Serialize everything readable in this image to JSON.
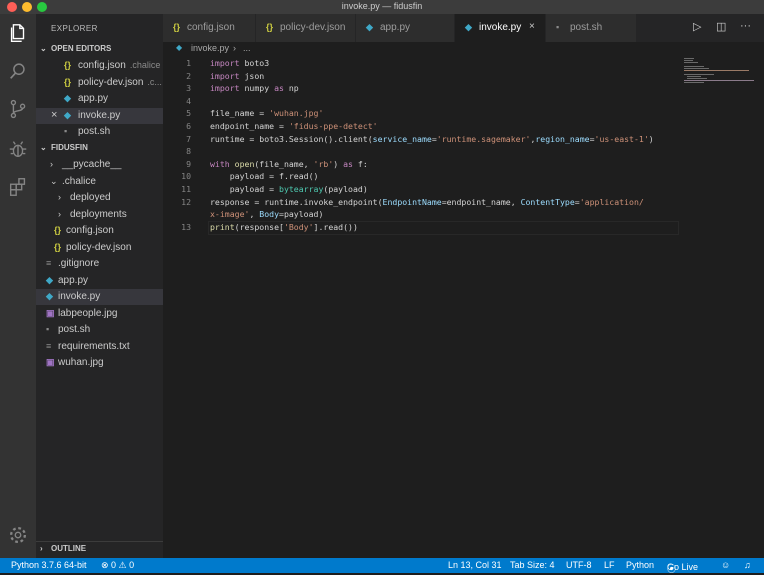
{
  "window": {
    "title": "invoke.py — fidusfin"
  },
  "sidebar": {
    "title": "EXPLORER",
    "open_editors_label": "OPEN EDITORS",
    "open_editors": [
      {
        "icon": "{}",
        "color": "#cbcb41",
        "name": "config.json",
        "suffix": ".chalice"
      },
      {
        "icon": "{}",
        "color": "#cbcb41",
        "name": "policy-dev.json",
        "suffix": ".c..."
      },
      {
        "icon": "◆",
        "color": "#3fa8c7",
        "name": "app.py",
        "suffix": ""
      },
      {
        "icon": "◆",
        "color": "#3fa8c7",
        "name": "invoke.py",
        "suffix": ""
      },
      {
        "icon": "▪",
        "color": "#8b8b8b",
        "name": "post.sh",
        "suffix": ""
      }
    ],
    "project_label": "FIDUSFIN",
    "tree": [
      {
        "chevron": "›",
        "icon": "",
        "color": "",
        "name": "__pycache__"
      },
      {
        "chevron": "⌄",
        "icon": "",
        "color": "",
        "name": ".chalice"
      },
      {
        "chevron": "›",
        "icon": "",
        "color": "",
        "name": "deployed"
      },
      {
        "chevron": "›",
        "icon": "",
        "color": "",
        "name": "deployments"
      },
      {
        "chevron": "",
        "icon": "{}",
        "color": "#cbcb41",
        "name": "config.json"
      },
      {
        "chevron": "",
        "icon": "{}",
        "color": "#cbcb41",
        "name": "policy-dev.json"
      },
      {
        "chevron": "",
        "icon": "≡",
        "color": "#8b8b8b",
        "name": ".gitignore"
      },
      {
        "chevron": "",
        "icon": "◆",
        "color": "#3fa8c7",
        "name": "app.py"
      },
      {
        "chevron": "",
        "icon": "◆",
        "color": "#3fa8c7",
        "name": "invoke.py"
      },
      {
        "chevron": "",
        "icon": "▣",
        "color": "#a074c4",
        "name": "labpeople.jpg"
      },
      {
        "chevron": "",
        "icon": "▪",
        "color": "#8b8b8b",
        "name": "post.sh"
      },
      {
        "chevron": "",
        "icon": "≡",
        "color": "#8b8b8b",
        "name": "requirements.txt"
      },
      {
        "chevron": "",
        "icon": "▣",
        "color": "#a074c4",
        "name": "wuhan.jpg"
      }
    ],
    "outline_label": "OUTLINE"
  },
  "tabs": [
    {
      "icon": "{}",
      "color": "#cbcb41",
      "name": "config.json"
    },
    {
      "icon": "{}",
      "color": "#cbcb41",
      "name": "policy-dev.json"
    },
    {
      "icon": "◆",
      "color": "#3fa8c7",
      "name": "app.py"
    },
    {
      "icon": "◆",
      "color": "#3fa8c7",
      "name": "invoke.py"
    },
    {
      "icon": "▪",
      "color": "#8b8b8b",
      "name": "post.sh"
    }
  ],
  "tab_actions": {
    "run": "▷",
    "split": "◫",
    "more": "···"
  },
  "breadcrumb": {
    "file": "invoke.py",
    "sep": "›",
    "rest": "..."
  },
  "code_lines": [
    {
      "num": "1",
      "tokens": [
        [
          "kw",
          "import"
        ],
        [
          "txt",
          " boto3"
        ]
      ]
    },
    {
      "num": "2",
      "tokens": [
        [
          "kw",
          "import"
        ],
        [
          "txt",
          " json"
        ]
      ]
    },
    {
      "num": "3",
      "tokens": [
        [
          "kw",
          "import"
        ],
        [
          "txt",
          " numpy "
        ],
        [
          "kw",
          "as"
        ],
        [
          "txt",
          " np"
        ]
      ]
    },
    {
      "num": "4",
      "tokens": []
    },
    {
      "num": "5",
      "tokens": [
        [
          "txt",
          "file_name = "
        ],
        [
          "str",
          "'wuhan.jpg'"
        ]
      ]
    },
    {
      "num": "6",
      "tokens": [
        [
          "txt",
          "endpoint_name = "
        ],
        [
          "str",
          "'fidus-ppe-detect'"
        ]
      ]
    },
    {
      "num": "7",
      "tokens": [
        [
          "txt",
          "runtime = boto3.Session().client("
        ],
        [
          "var",
          "service_name"
        ],
        [
          "txt",
          "="
        ],
        [
          "str",
          "'runtime.sagemaker'"
        ],
        [
          "txt",
          ","
        ],
        [
          "var",
          "region_name"
        ],
        [
          "txt",
          "="
        ],
        [
          "str",
          "'us-east-1'"
        ],
        [
          "txt",
          ")"
        ]
      ]
    },
    {
      "num": "8",
      "tokens": []
    },
    {
      "num": "9",
      "tokens": [
        [
          "kw",
          "with"
        ],
        [
          "txt",
          " "
        ],
        [
          "fn",
          "open"
        ],
        [
          "txt",
          "(file_name, "
        ],
        [
          "str",
          "'rb'"
        ],
        [
          "txt",
          ") "
        ],
        [
          "kw",
          "as"
        ],
        [
          "txt",
          " f:"
        ]
      ]
    },
    {
      "num": "10",
      "tokens": [
        [
          "txt",
          "    payload = f.read()"
        ]
      ]
    },
    {
      "num": "11",
      "tokens": [
        [
          "txt",
          "    payload = "
        ],
        [
          "cls2",
          "bytearray"
        ],
        [
          "txt",
          "(payload)"
        ]
      ]
    },
    {
      "num": "12",
      "tokens": [
        [
          "txt",
          "response = runtime.invoke_endpoint("
        ],
        [
          "var",
          "EndpointName"
        ],
        [
          "txt",
          "=endpoint_name, "
        ],
        [
          "var",
          "ContentType"
        ],
        [
          "txt",
          "="
        ],
        [
          "str",
          "'application/"
        ]
      ]
    },
    {
      "num": "",
      "tokens": [
        [
          "str",
          "x-image'"
        ],
        [
          "txt",
          ", "
        ],
        [
          "var",
          "Body"
        ],
        [
          "txt",
          "=payload)"
        ]
      ]
    },
    {
      "num": "13",
      "tokens": [
        [
          "fn",
          "print"
        ],
        [
          "txt",
          "(response["
        ],
        [
          "str",
          "'Body'"
        ],
        [
          "txt",
          "].read())"
        ]
      ]
    }
  ],
  "statusbar": {
    "python": "Python 3.7.6 64-bit",
    "errors": "⊗ 0 ⚠ 0",
    "position": "Ln 13, Col 31",
    "tabsize": "Tab Size: 4",
    "encoding": "UTF-8",
    "eol": "LF",
    "language": "Python",
    "golive": "Go Live"
  }
}
